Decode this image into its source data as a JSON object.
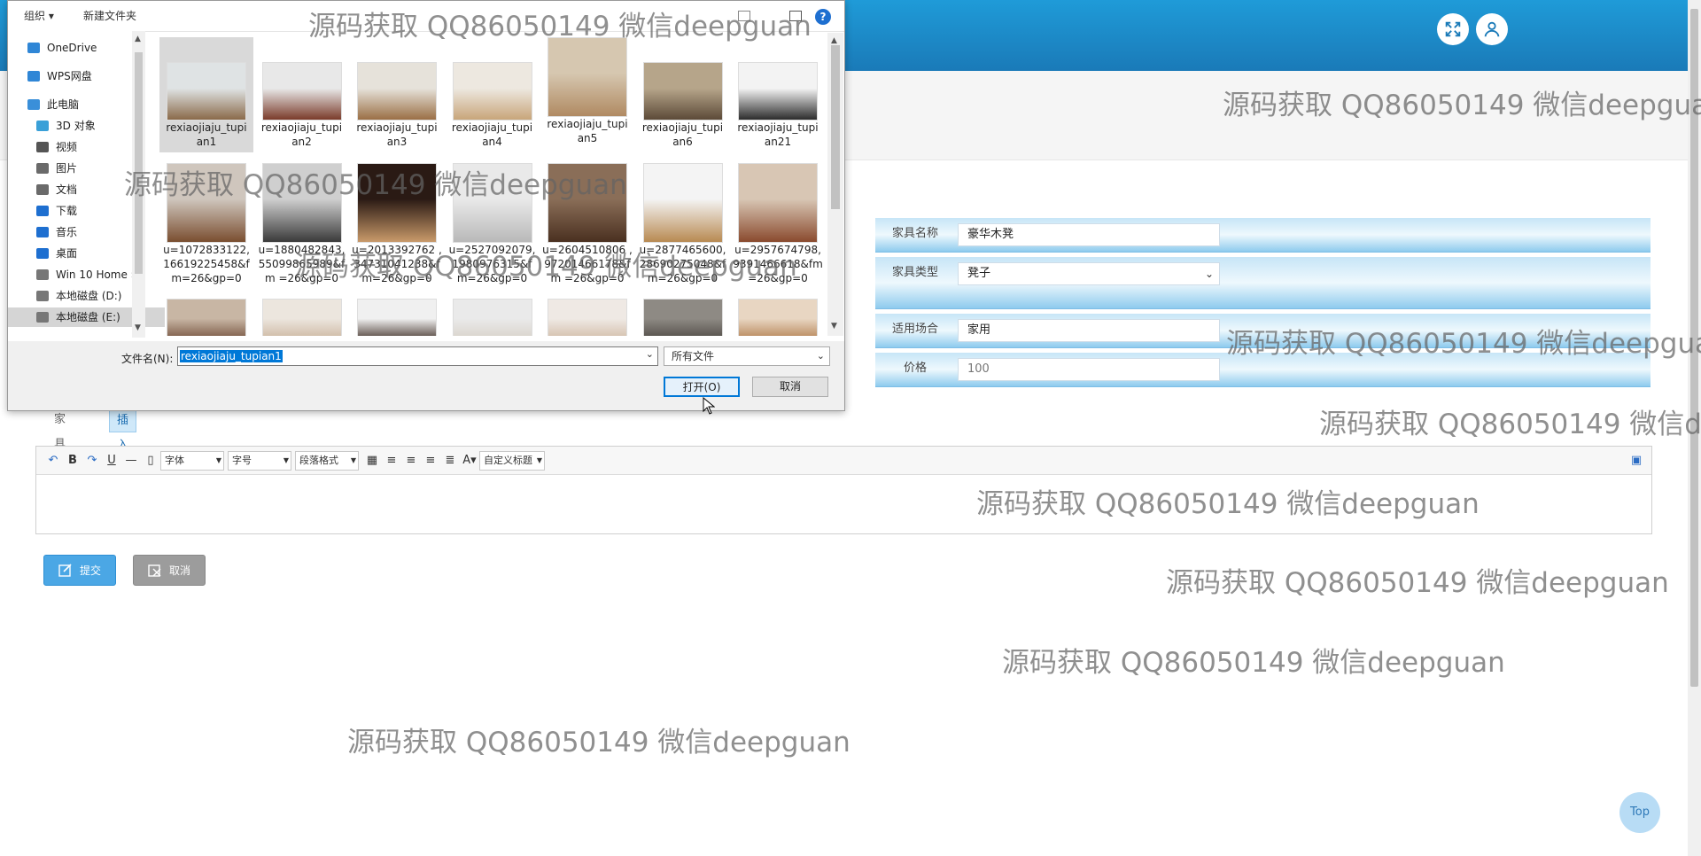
{
  "form": {
    "fields": [
      {
        "label": "家具名称",
        "value": "豪华木凳"
      },
      {
        "label": "家具类型",
        "value": "凳子"
      },
      {
        "label": "适用场合",
        "value": "家用"
      },
      {
        "label": "价格",
        "placeholder": "100"
      }
    ]
  },
  "tabs": [
    "家具详情",
    "插入图片"
  ],
  "editor": {
    "font_select": "字体",
    "size_select": "字号",
    "paragraph_select": "段落格式",
    "custom_title_select": "自定义标题"
  },
  "actions": {
    "submit": "提交",
    "cancel": "取消"
  },
  "top_button": "Top",
  "watermark": "源码获取 QQ86050149 微信deepguan",
  "dialog": {
    "organize": "组织 ▾",
    "new_folder": "新建文件夹",
    "help": "?",
    "nav": [
      {
        "label": "OneDrive",
        "icon": "cloud-icon",
        "color": "#2f86d6"
      },
      {
        "label": "WPS网盘",
        "icon": "cloud-icon",
        "color": "#2f86d6"
      },
      {
        "label": "此电脑",
        "icon": "computer-icon",
        "color": "#3a8fd9"
      },
      {
        "label": "3D 对象",
        "icon": "cube-icon",
        "color": "#3aa0d8"
      },
      {
        "label": "视频",
        "icon": "video-icon",
        "color": "#555555"
      },
      {
        "label": "图片",
        "icon": "pictures-icon",
        "color": "#6a6a6a"
      },
      {
        "label": "文档",
        "icon": "document-icon",
        "color": "#6a6a6a"
      },
      {
        "label": "下载",
        "icon": "download-icon",
        "color": "#1e6fd0"
      },
      {
        "label": "音乐",
        "icon": "music-icon",
        "color": "#1e6fd0"
      },
      {
        "label": "桌面",
        "icon": "desktop-icon",
        "color": "#1e6fd0"
      },
      {
        "label": "Win 10 Home ›",
        "icon": "drive-icon",
        "color": "#777777"
      },
      {
        "label": "本地磁盘 (D:)",
        "icon": "drive-icon",
        "color": "#777777"
      },
      {
        "label": "本地磁盘 (E:)",
        "icon": "drive-icon",
        "color": "#777777"
      }
    ],
    "files": [
      {
        "name": "rexiaojiaju_tupian1",
        "label": "rexiaojiaju_tupi an1"
      },
      {
        "name": "rexiaojiaju_tupian2",
        "label": "rexiaojiaju_tupi an2"
      },
      {
        "name": "rexiaojiaju_tupian3",
        "label": "rexiaojiaju_tupi an3"
      },
      {
        "name": "rexiaojiaju_tupian4",
        "label": "rexiaojiaju_tupi an4"
      },
      {
        "name": "rexiaojiaju_tupian5",
        "label": "rexiaojiaju_tupi an5"
      },
      {
        "name": "rexiaojiaju_tupian6",
        "label": "rexiaojiaju_tupi an6"
      },
      {
        "name": "rexiaojiaju_tupian21",
        "label": "rexiaojiaju_tupi an21"
      },
      {
        "name": "u=1072833122",
        "label": "u=1072833122, 16619225458&f m=26&gp=0"
      },
      {
        "name": "u=1880482843",
        "label": "u=1880482843, 55099865989&fm =26&gp=0"
      },
      {
        "name": "u=2013392762",
        "label": "u=2013392762 ,34731041238&f m=26&gp=0"
      },
      {
        "name": "u=2527092079",
        "label": "u=2527092079, 1980976315&f m=26&gp=0"
      },
      {
        "name": "u=2604510806",
        "label": "u=2604510806 ,97201466178&fm =26&gp=0"
      },
      {
        "name": "u=2877465600",
        "label": "u=2877465600, 28690275048&f m=26&gp=0"
      },
      {
        "name": "u=2957674798",
        "label": "u=2957674798, 9391466618&fm =26&gp=0"
      },
      {
        "name": "row3-1",
        "label": ""
      },
      {
        "name": "row3-2",
        "label": ""
      },
      {
        "name": "row3-3",
        "label": ""
      },
      {
        "name": "row3-4",
        "label": ""
      },
      {
        "name": "row3-5",
        "label": ""
      },
      {
        "name": "row3-6",
        "label": ""
      },
      {
        "name": "row3-7",
        "label": ""
      }
    ],
    "filename_label": "文件名(N):",
    "filename_value": "rexiaojiaju_tupian1",
    "filetype_value": "所有文件",
    "open_button": "打开(O)",
    "cancel_button": "取消"
  }
}
